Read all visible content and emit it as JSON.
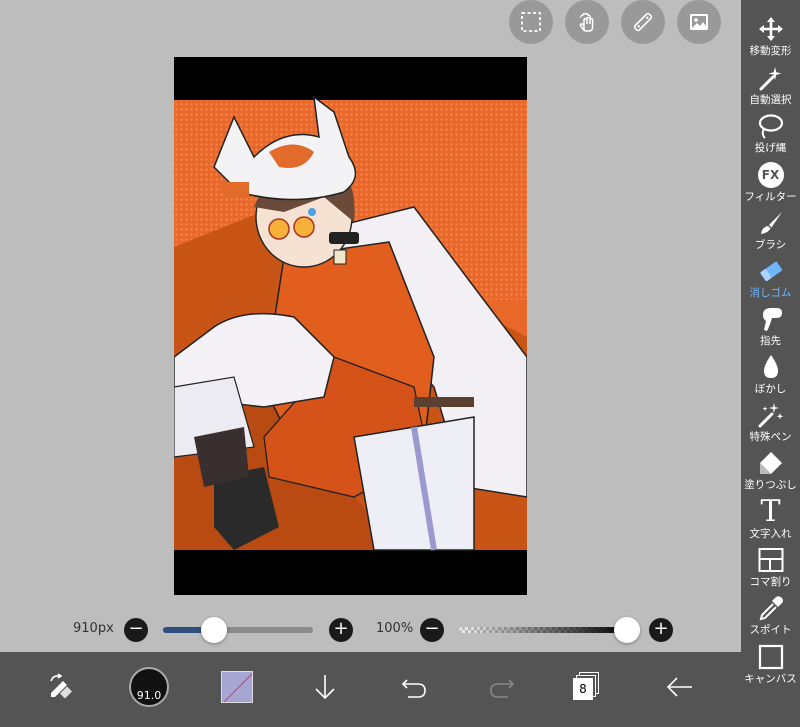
{
  "top_tools": [
    {
      "icon": "selection-icon"
    },
    {
      "icon": "gesture-icon"
    },
    {
      "icon": "ruler-icon"
    },
    {
      "icon": "material-icon"
    }
  ],
  "brush_size": {
    "label": "910px",
    "value": 0.34
  },
  "opacity": {
    "label": "100%",
    "value": 1.0
  },
  "bottom_bar": {
    "brush_size_badge": "91.0",
    "layer_count": "8",
    "color_swatch": "#a6a6d4"
  },
  "right_tools": [
    {
      "label": "移動変形",
      "icon": "move-icon"
    },
    {
      "label": "自動選択",
      "icon": "magic-wand-icon"
    },
    {
      "label": "投げ縄",
      "icon": "lasso-icon"
    },
    {
      "label": "フィルター",
      "icon": "fx-icon"
    },
    {
      "label": "ブラシ",
      "icon": "brush-icon"
    },
    {
      "label": "消しゴム",
      "icon": "eraser-icon",
      "active": true
    },
    {
      "label": "指先",
      "icon": "finger-icon"
    },
    {
      "label": "ぼかし",
      "icon": "blur-drop-icon"
    },
    {
      "label": "特殊ペン",
      "icon": "special-pen-icon"
    },
    {
      "label": "塗りつぶし",
      "icon": "fill-icon"
    },
    {
      "label": "文字入れ",
      "icon": "text-icon"
    },
    {
      "label": "コマ割り",
      "icon": "panel-icon"
    },
    {
      "label": "スポイト",
      "icon": "eyedropper-icon"
    },
    {
      "label": "キャンバス",
      "icon": "canvas-icon"
    }
  ],
  "colors": {
    "accent": "#6fb6ff",
    "toolbar": "#545454",
    "background": "#bdbdbd",
    "slider_fill": "#2f4f7f"
  }
}
